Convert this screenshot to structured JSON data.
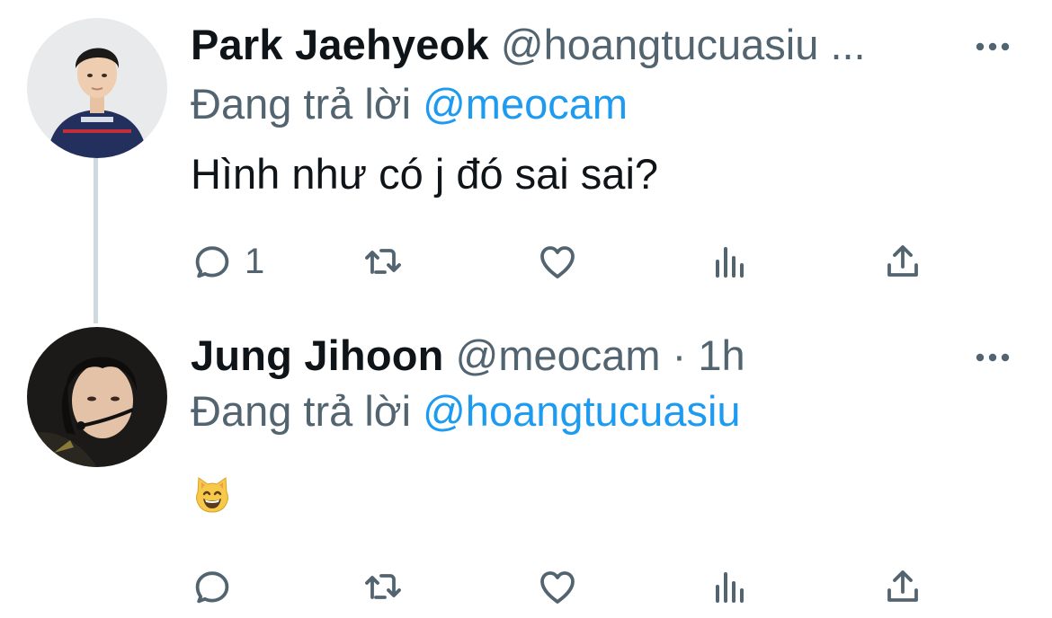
{
  "tweets": [
    {
      "name": "Park Jaehyeok",
      "handle": "@hoangtucuasiu",
      "ellipsis": "...",
      "replying_prefix": "Đang trả lời",
      "replying_to": "@meocam",
      "text": "Hình như có j đó sai sai?",
      "reply_count": "1",
      "avatar": "man-in-navy-jersey-photo"
    },
    {
      "name": "Jung Jihoon",
      "handle": "@meocam",
      "separator": "·",
      "time": "1h",
      "replying_prefix": "Đang trả lời",
      "replying_to": "@hoangtucuasiu",
      "emoji": "grinning-cat-face",
      "avatar": "person-with-headset-photo"
    }
  ],
  "icons": {
    "reply": "reply-icon",
    "retweet": "retweet-icon",
    "like": "like-icon",
    "views": "views-icon",
    "share": "share-icon",
    "more": "more-options-icon"
  },
  "colors": {
    "text": "#0f1419",
    "secondary": "#536471",
    "link": "#1d9bf0",
    "thread_line": "#cfd9de"
  }
}
